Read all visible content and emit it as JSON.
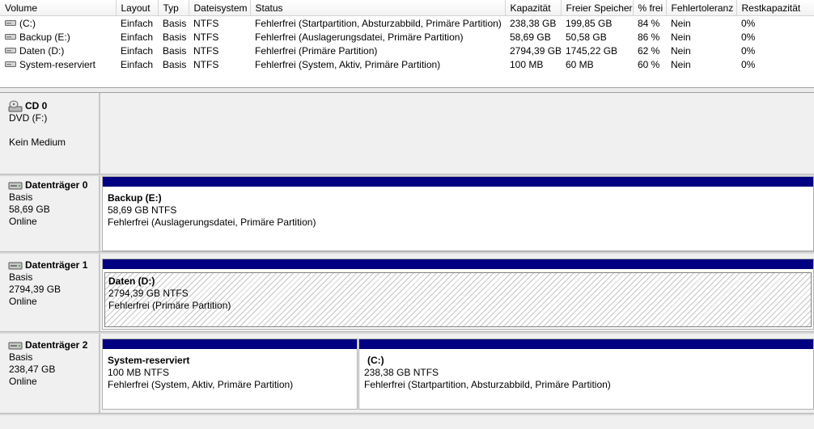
{
  "columns": [
    "Volume",
    "Layout",
    "Typ",
    "Dateisystem",
    "Status",
    "Kapazität",
    "Freier Speicher",
    "% frei",
    "Fehlertoleranz",
    "Restkapazität"
  ],
  "volumes": [
    {
      "name": "(C:)",
      "layout": "Einfach",
      "typ": "Basis",
      "fs": "NTFS",
      "status": "Fehlerfrei (Startpartition, Absturzabbild, Primäre Partition)",
      "kapazitaet": "238,38 GB",
      "frei": "199,85 GB",
      "prozent": "84 %",
      "fehlertoleranz": "Nein",
      "rest": "0%"
    },
    {
      "name": "Backup (E:)",
      "layout": "Einfach",
      "typ": "Basis",
      "fs": "NTFS",
      "status": "Fehlerfrei (Auslagerungsdatei, Primäre Partition)",
      "kapazitaet": "58,69 GB",
      "frei": "50,58 GB",
      "prozent": "86 %",
      "fehlertoleranz": "Nein",
      "rest": "0%"
    },
    {
      "name": "Daten (D:)",
      "layout": "Einfach",
      "typ": "Basis",
      "fs": "NTFS",
      "status": "Fehlerfrei (Primäre Partition)",
      "kapazitaet": "2794,39 GB",
      "frei": "1745,22 GB",
      "prozent": "62 %",
      "fehlertoleranz": "Nein",
      "rest": "0%"
    },
    {
      "name": "System-reserviert",
      "layout": "Einfach",
      "typ": "Basis",
      "fs": "NTFS",
      "status": "Fehlerfrei (System, Aktiv, Primäre Partition)",
      "kapazitaet": "100 MB",
      "frei": "60 MB",
      "prozent": "60 %",
      "fehlertoleranz": "Nein",
      "rest": "0%"
    }
  ],
  "cd": {
    "title": "CD 0",
    "line1": "DVD (F:)",
    "line2": "Kein Medium"
  },
  "disks": [
    {
      "title": "Datenträger 0",
      "typ": "Basis",
      "size": "58,69 GB",
      "state": "Online",
      "partitions": [
        {
          "name": "Backup  (E:)",
          "size": "58,69 GB NTFS",
          "status": "Fehlerfrei (Auslagerungsdatei, Primäre Partition)"
        }
      ]
    },
    {
      "title": "Datenträger 1",
      "typ": "Basis",
      "size": "2794,39 GB",
      "state": "Online",
      "partitions": [
        {
          "name": "Daten  (D:)",
          "size": "2794,39 GB NTFS",
          "status": "Fehlerfrei (Primäre Partition)"
        }
      ]
    },
    {
      "title": "Datenträger 2",
      "typ": "Basis",
      "size": "238,47 GB",
      "state": "Online",
      "partitions": [
        {
          "name": "System-reserviert",
          "size": "100 MB NTFS",
          "status": "Fehlerfrei (System, Aktiv, Primäre Partition)"
        },
        {
          "name": "(C:)",
          "size": "238,38 GB NTFS",
          "status": "Fehlerfrei (Startpartition, Absturzabbild, Primäre Partition)"
        }
      ]
    }
  ],
  "colors": {
    "partition_bar": "#000080"
  },
  "icons": {
    "volume": "drive-icon",
    "disk": "hard-disk-icon",
    "cd": "cd-drive-icon"
  }
}
